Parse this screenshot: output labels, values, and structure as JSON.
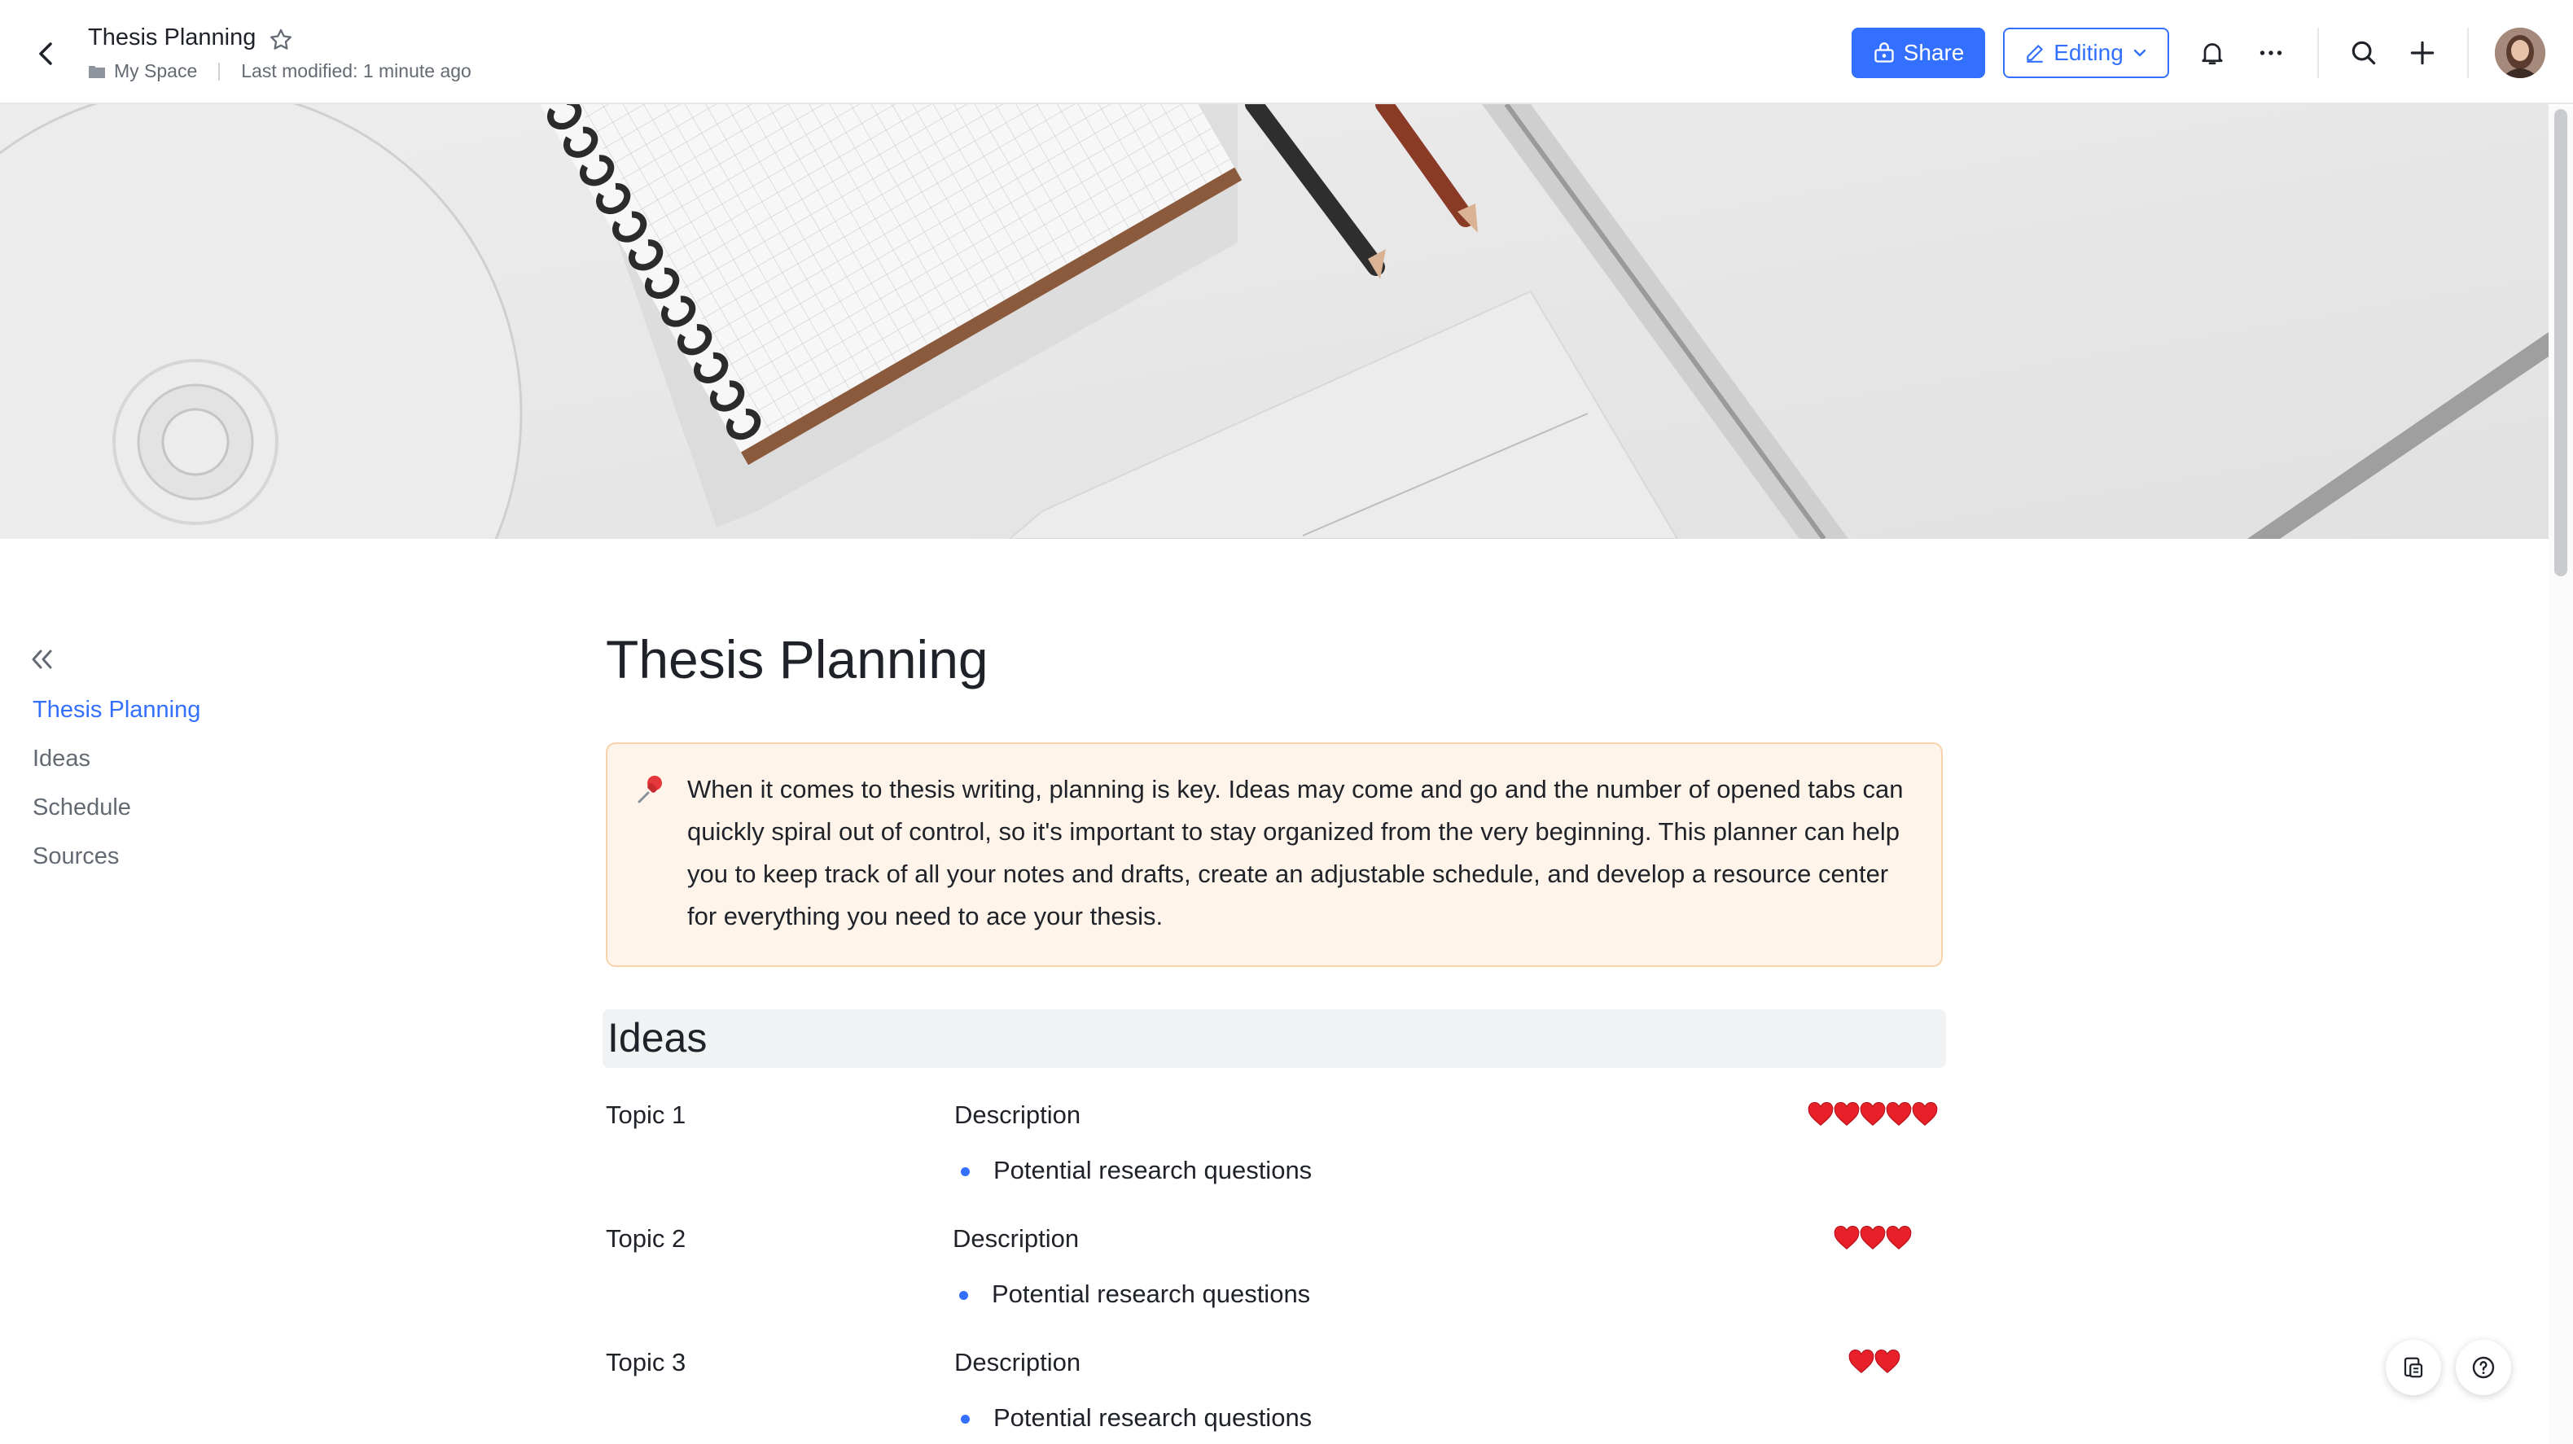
{
  "header": {
    "title": "Thesis Planning",
    "location": "My Space",
    "last_modified": "Last modified: 1 minute ago",
    "share_label": "Share",
    "mode_label": "Editing"
  },
  "outline": {
    "items": [
      {
        "label": "Thesis Planning",
        "active": true
      },
      {
        "label": "Ideas",
        "active": false
      },
      {
        "label": "Schedule",
        "active": false
      },
      {
        "label": "Sources",
        "active": false
      }
    ]
  },
  "document": {
    "title": "Thesis Planning",
    "callout": "When it comes to thesis writing, planning is key. Ideas may come and go and the number of opened tabs can quickly spiral out of control, so it's important to stay organized from the very beginning. This planner can help you to keep track of all your notes and drafts, create an adjustable schedule, and develop a resource center for everything you need to ace your thesis.",
    "ideas_heading": "Ideas",
    "ideas": [
      {
        "topic": "Topic 1",
        "description": "Description",
        "bullet": "Potential research questions",
        "hearts": 5
      },
      {
        "topic": "Topic 2",
        "description": "Description",
        "bullet": "Potential research questions",
        "hearts": 3
      },
      {
        "topic": "Topic 3",
        "description": "Description",
        "bullet": "Potential research questions",
        "hearts": 2
      }
    ]
  },
  "colors": {
    "accent": "#3370ff",
    "callout_bg": "#fef4ea",
    "callout_border": "#f8d3aa",
    "heart": "#e8202a"
  }
}
